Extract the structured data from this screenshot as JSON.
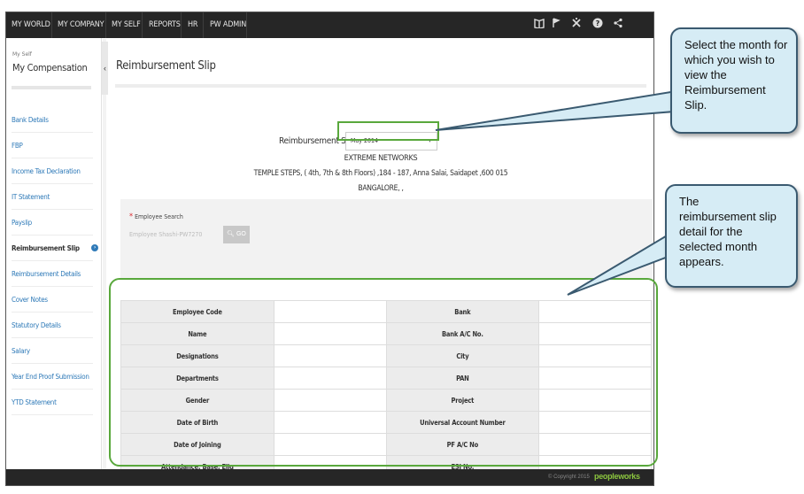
{
  "topnav": {
    "items": [
      "MY WORLD",
      "MY COMPANY",
      "MY SELF",
      "REPORTS",
      "HR",
      "PW ADMIN"
    ],
    "icons": [
      "book-icon",
      "flag-icon",
      "tools-icon",
      "help-icon",
      "share-icon"
    ]
  },
  "sidebar": {
    "breadcrumb": "My Self",
    "title": "My Compensation",
    "items": [
      {
        "label": "Bank Details"
      },
      {
        "label": "FBP"
      },
      {
        "label": "Income Tax Declaration"
      },
      {
        "label": "IT Statement"
      },
      {
        "label": "Payslip"
      },
      {
        "label": "Reimbursement Slip",
        "active": true
      },
      {
        "label": "Reimbursement Details"
      },
      {
        "label": "Cover Notes"
      },
      {
        "label": "Statutory Details"
      },
      {
        "label": "Salary"
      },
      {
        "label": "Year End Proof Submission"
      },
      {
        "label": "YTD Statement"
      }
    ]
  },
  "main": {
    "title": "Reimbursement Slip",
    "selector_label": "Reimbursement Slip",
    "selected_month": "May 2014",
    "company_name": "EXTREME NETWORKS",
    "company_address": "TEMPLE STEPS, ( 4th, 7th & 8th Floors) ,184 - 187, Anna Salai, Saidapet ,600 015",
    "company_city": "BANGALORE, ,",
    "employee_search_label": "Employee Search",
    "employee_search_value": "Employee Shashi-PW7270",
    "go_label": "GO",
    "table_rows": [
      {
        "left": "Employee Code",
        "right": "Bank"
      },
      {
        "left": "Name",
        "right": "Bank A/C No."
      },
      {
        "left": "Designations",
        "right": "City"
      },
      {
        "left": "Departments",
        "right": "PAN"
      },
      {
        "left": "Gender",
        "right": "Project"
      },
      {
        "left": "Date of Birth",
        "right": "Universal Account Number"
      },
      {
        "left": "Date of Joining",
        "right": "PF A/C No"
      },
      {
        "left": "Attendance: Base, Elig",
        "right": "ESI No."
      }
    ]
  },
  "footer": {
    "copyright": "© Copyright 2015",
    "brand": "peopleworks"
  },
  "callouts": {
    "month": "Select the month for which you wish to view the Reimbursement Slip.",
    "detail": "The reimbursement slip detail for the selected month appears."
  },
  "colors": {
    "topbar": "#262626",
    "link": "#2f7ab8",
    "highlight": "#59a83c",
    "callout_fill": "#d6ecf5",
    "callout_border": "#3a5a70"
  }
}
